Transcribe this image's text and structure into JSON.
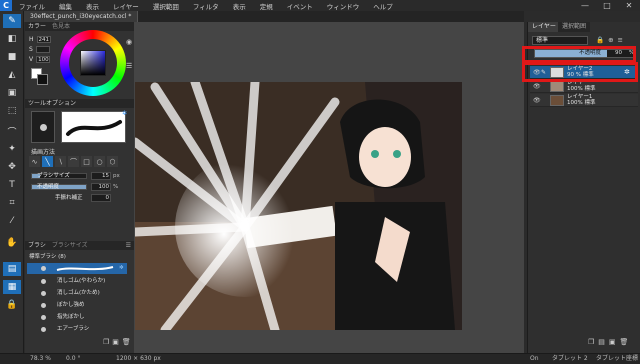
{
  "app": {
    "logo": "C"
  },
  "menu": [
    "ファイル",
    "編集",
    "表示",
    "レイヤー",
    "選択範囲",
    "フィルタ",
    "表示",
    "定規",
    "イベント",
    "ウィンドウ",
    "ヘルプ"
  ],
  "window_controls": [
    "—",
    "□",
    "✕"
  ],
  "document": {
    "tab_label": "30effect_punch_i30eyecatch.ocl *"
  },
  "color_panel": {
    "tabs": [
      "カラー",
      "色見本"
    ],
    "h_label": "H",
    "h_value": "241",
    "s_label": "S",
    "s_value": "",
    "v_label": "V",
    "v_value": "100"
  },
  "tool_option": {
    "title": "ツールオプション",
    "section_label": "描画方法",
    "brush_size_label": "ブラシサイズ",
    "brush_size_value": "15",
    "brush_size_unit": "px",
    "brush_size_level": 0.15,
    "opacity_label": "不透明度",
    "opacity_value": "100",
    "opacity_unit": "%",
    "opacity_level": 1.0,
    "correction_label": "手振れ補正",
    "correction_value": "0"
  },
  "brush_panel": {
    "tabs": [
      "ブラシ",
      "ブラシサイズ"
    ],
    "group_label": "標準ブラシ (8)",
    "items": [
      "",
      "消しゴム(やわらか)",
      "消しゴム(かため)",
      "ぼかし強め",
      "指先ぼかし",
      "エアーブラシ"
    ]
  },
  "layer_panel": {
    "tabs": [
      "レイヤー",
      "選択範囲"
    ],
    "blend_mode": "標準",
    "opacity_label": "不透明度",
    "opacity_value": "90",
    "opacity_unit": "%",
    "layers": [
      {
        "name": "レイヤー2",
        "info": "90 % 標準"
      },
      {
        "name": "レイヤー",
        "info": "100% 標準"
      },
      {
        "name": "レイヤー1",
        "info": "100% 標準"
      }
    ]
  },
  "status": {
    "zoom": "78.3 %",
    "angle": "0.0 °",
    "size": "1200 × 630 px",
    "on": "On",
    "tablet": "タブレット 2",
    "tablet_coord": "タブレット座標"
  },
  "colors": {
    "accent": "#1f6fb8",
    "highlight_box": "#e01818"
  }
}
